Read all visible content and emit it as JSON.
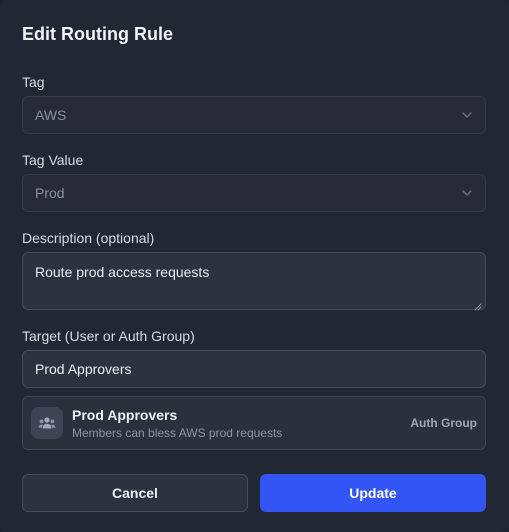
{
  "dialog": {
    "title": "Edit Routing Rule"
  },
  "tag": {
    "label": "Tag",
    "value": "AWS"
  },
  "tag_value": {
    "label": "Tag Value",
    "value": "Prod"
  },
  "description": {
    "label": "Description (optional)",
    "value": "Route prod access requests"
  },
  "target": {
    "label": "Target (User or Auth Group)",
    "value": "Prod Approvers",
    "result": {
      "name": "Prod Approvers",
      "description": "Members can bless AWS prod requests",
      "type": "Auth Group",
      "icon": "users-group-icon"
    }
  },
  "buttons": {
    "cancel": "Cancel",
    "update": "Update"
  },
  "colors": {
    "primary": "#3355f5",
    "background": "#222734"
  }
}
